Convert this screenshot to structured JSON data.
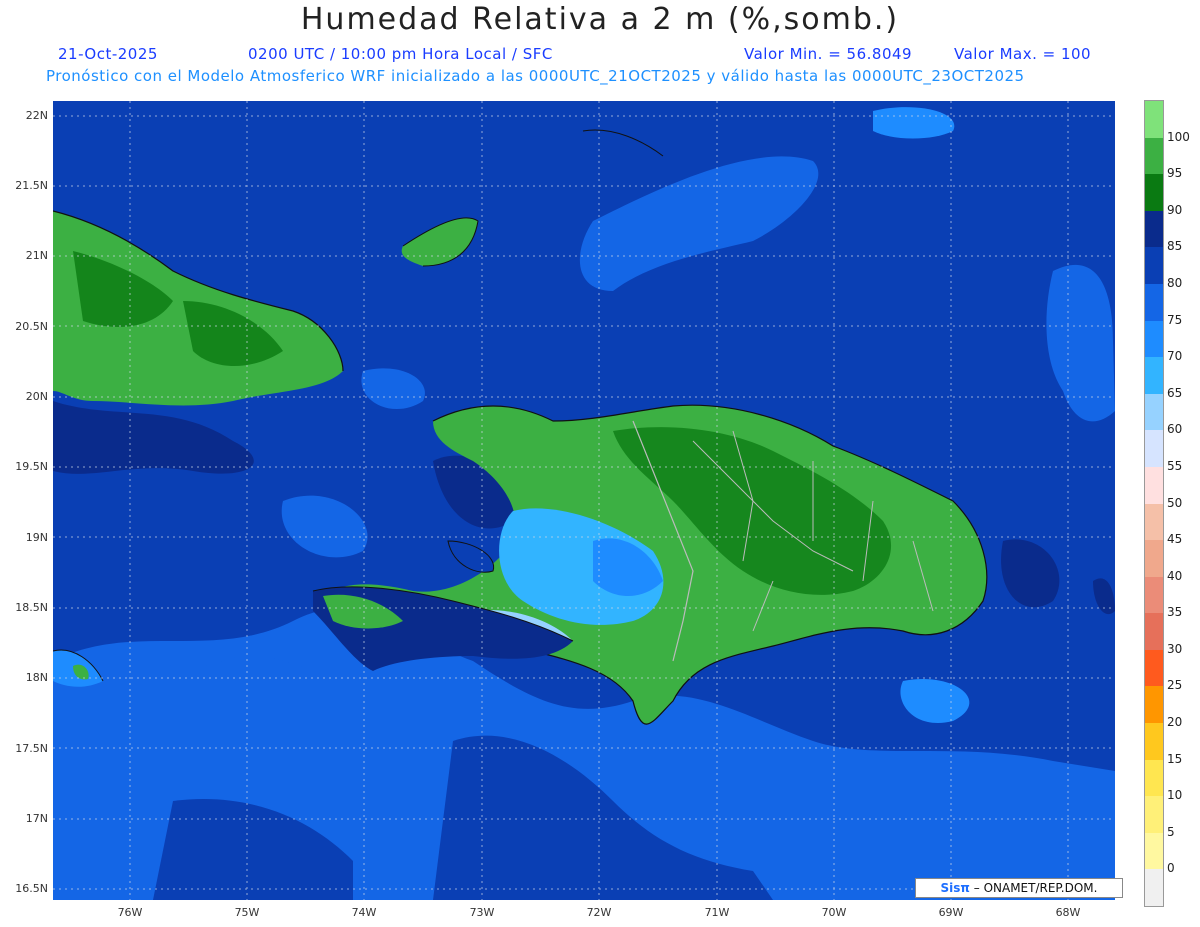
{
  "header": {
    "title": "Humedad Relativa a 2 m (%,somb.)",
    "date": "21-Oct-2025",
    "time": "0200 UTC / 10:00 pm Hora Local / SFC",
    "min_value": "Valor Min. = 56.8049",
    "max_value": "Valor Max. = 100",
    "subtitle": "Pronóstico con el Modelo Atmosferico WRF inicializado a las 0000UTC_21OCT2025 y válido hasta las  0000UTC_23OCT2025"
  },
  "axes": {
    "lat_labels": [
      "22N",
      "21.5N",
      "21N",
      "20.5N",
      "20N",
      "19.5N",
      "19N",
      "18.5N",
      "18N",
      "17.5N",
      "17N",
      "16.5N"
    ],
    "lon_labels": [
      "76W",
      "75W",
      "74W",
      "73W",
      "72W",
      "71W",
      "70W",
      "69W",
      "68W"
    ]
  },
  "legend": {
    "labels": [
      "100",
      "95",
      "90",
      "85",
      "80",
      "75",
      "70",
      "65",
      "60",
      "55",
      "50",
      "45",
      "40",
      "35",
      "30",
      "25",
      "20",
      "15",
      "10",
      "5",
      "0"
    ],
    "colors": [
      "#7fe27a",
      "#3cb043",
      "#0a7a12",
      "#0a2b8c",
      "#0a3fb4",
      "#1466e6",
      "#1e8cff",
      "#32b4ff",
      "#96d2ff",
      "#d6e4ff",
      "#ffe0e0",
      "#f5c0a8",
      "#f0a88c",
      "#eb8c78",
      "#e6705a",
      "#ff5a1e",
      "#ff9600",
      "#ffc81e",
      "#ffe650",
      "#fff078",
      "#fff8a0",
      "#f0f0f0"
    ]
  },
  "credit": {
    "brand": "Sisπ",
    "text": "– ONAMET/REP.DOM."
  },
  "palette": {
    "ocean_base": "#0a3fb4",
    "ocean_dark": "#0a2b8c",
    "ocean_light": "#1466e6",
    "green_dark": "#0a7a12",
    "green_mid": "#3cb043",
    "green_light": "#7fe27a",
    "cyan_light": "#32b4ff",
    "pale": "#96d2ff"
  }
}
